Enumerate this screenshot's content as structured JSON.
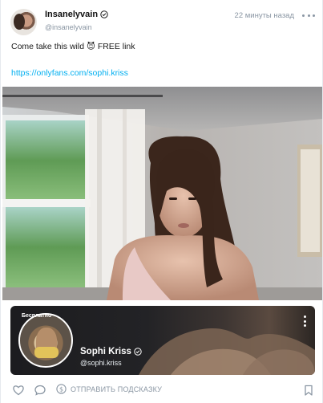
{
  "post": {
    "author": {
      "display_name": "Insanelyvain",
      "handle": "@insanelyvain"
    },
    "time": "22 минуты назад",
    "text": "Come take this wild 😈 FREE link",
    "link": "https://onlyfans.com/sophi.kriss"
  },
  "card": {
    "free_label": "Бесплатно",
    "name": "Sophi Kriss",
    "handle": "@sophi.kriss"
  },
  "actions": {
    "tip_label": "ОТПРАВИТЬ ПОДСКАЗКУ"
  },
  "icons": {
    "more": "more-horizontal-icon",
    "verified": "verified-icon",
    "like": "heart-icon",
    "comment": "comment-icon",
    "tip": "dollar-circle-icon",
    "bookmark": "bookmark-icon"
  },
  "colors": {
    "link": "#00aff0",
    "muted": "#8a96a3"
  }
}
